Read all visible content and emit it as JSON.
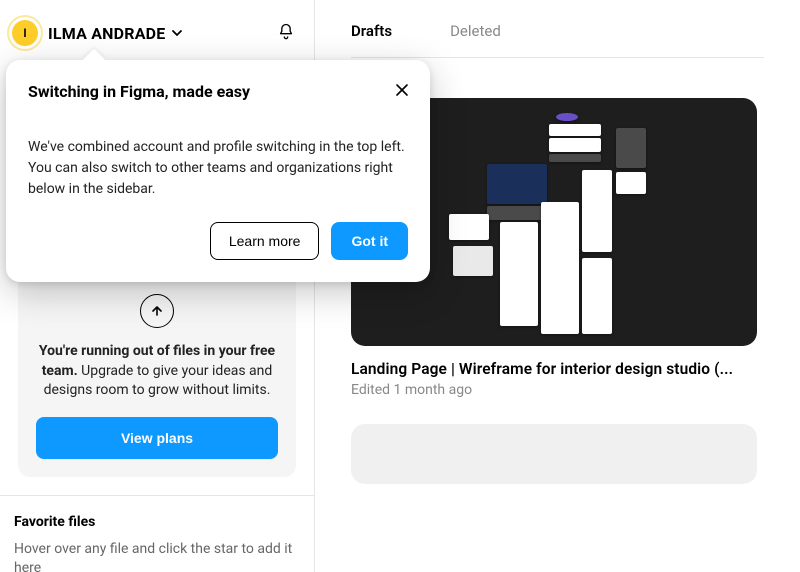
{
  "header": {
    "avatar_initial": "I",
    "user_name": "ILMA ANDRADE"
  },
  "popover": {
    "title": "Switching in Figma, made easy",
    "body": "We've combined account and profile switching in the top left. You can also switch to other teams and organizations right below in the sidebar.",
    "learn_more": "Learn more",
    "got_it": "Got it"
  },
  "upgrade": {
    "bold": "You're running out of files in your free team.",
    "rest": " Upgrade to give your ideas and designs room to grow without limits.",
    "cta": "View plans"
  },
  "favorites": {
    "title": "Favorite files",
    "hint": "Hover over any file and click the star to add it here"
  },
  "tabs": {
    "drafts": "Drafts",
    "deleted": "Deleted"
  },
  "file_card": {
    "title": "Landing Page | Wireframe for interior design studio (...",
    "meta": "Edited 1 month ago"
  }
}
